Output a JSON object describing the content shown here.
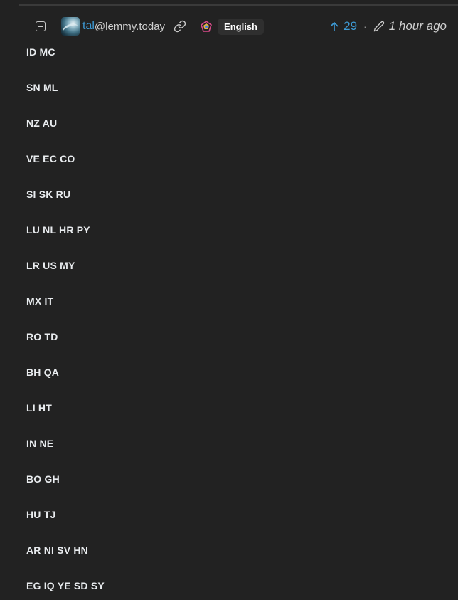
{
  "comment": {
    "user": {
      "name": "tal",
      "instance": "@lemmy.today",
      "avatar_icon": "user-avatar"
    },
    "language": "English",
    "score": "29",
    "separator": "·",
    "time": "1 hour ago",
    "icons": {
      "collapse": "collapse-minus-icon",
      "link": "link-icon",
      "language": "language-icon",
      "upvote": "arrow-up-icon",
      "edit": "pencil-icon"
    },
    "colors": {
      "background": "#222222",
      "accent": "#3e9bd6",
      "text": "#e9ecef"
    },
    "lines": [
      "ID MC",
      "SN ML",
      "NZ AU",
      "VE EC CO",
      "SI SK RU",
      "LU NL HR PY",
      "LR US MY",
      "MX IT",
      "RO TD",
      "BH QA",
      "LI HT",
      "IN NE",
      "BO GH",
      "HU TJ",
      "AR NI SV HN",
      "EG IQ YE SD SY"
    ]
  }
}
